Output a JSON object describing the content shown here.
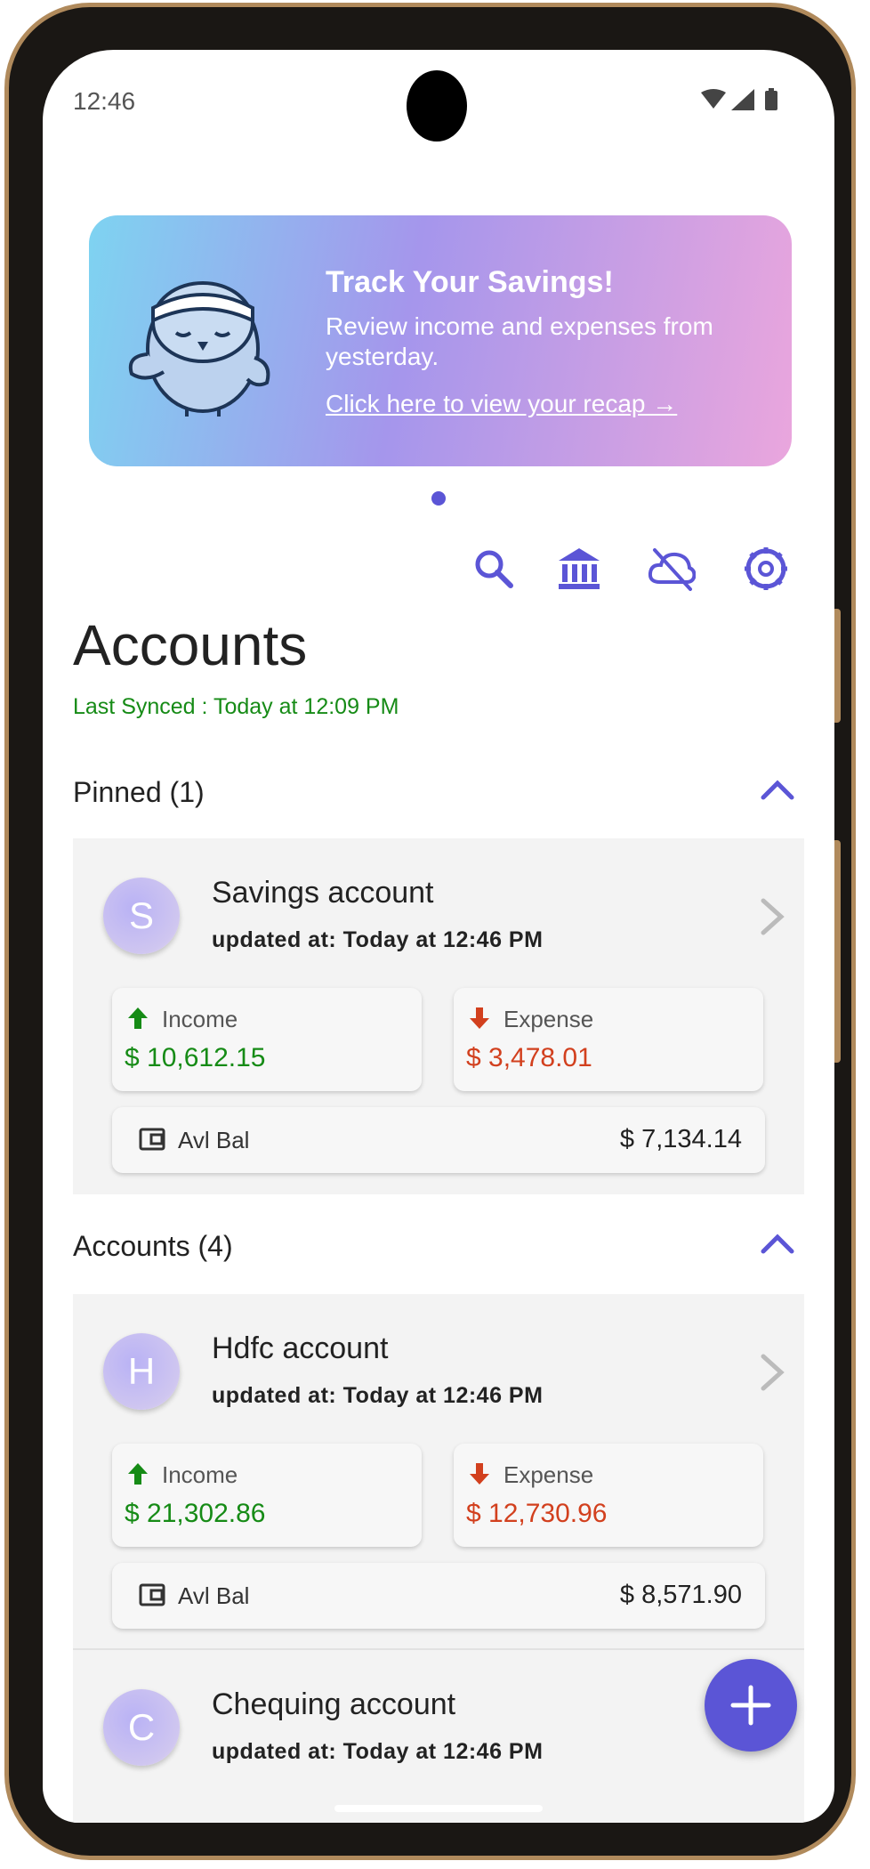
{
  "status_bar": {
    "time": "12:46"
  },
  "banner": {
    "title": "Track Your Savings!",
    "subtitle": "Review income and expenses from yesterday.",
    "link": " Click here to view your recap →"
  },
  "toolbar": {
    "icons": [
      "search-icon",
      "bank-icon",
      "cloud-off-icon",
      "settings-icon"
    ]
  },
  "page": {
    "title": "Accounts",
    "last_synced": "Last Synced : Today at 12:09 PM"
  },
  "pinned": {
    "header": "Pinned (1)",
    "accounts": [
      {
        "initial": "S",
        "name": "Savings account",
        "updated": "updated at: Today at 12:46 PM",
        "income_label": "Income",
        "income": "$ 10,612.15",
        "expense_label": "Expense",
        "expense": "$ 3,478.01",
        "balance_label": "Avl Bal",
        "balance": "$ 7,134.14"
      }
    ]
  },
  "accounts": {
    "header": "Accounts (4)",
    "items": [
      {
        "initial": "H",
        "name": "Hdfc account",
        "updated": "updated at: Today at 12:46 PM",
        "income_label": "Income",
        "income": "$ 21,302.86",
        "expense_label": "Expense",
        "expense": "$ 12,730.96",
        "balance_label": "Avl Bal",
        "balance": "$ 8,571.90"
      },
      {
        "initial": "C",
        "name": "Chequing account",
        "updated": "updated at: Today at 12:46 PM"
      }
    ]
  },
  "colors": {
    "accent": "#5b55d6",
    "income": "#168b16",
    "expense": "#d2401e",
    "synced": "#168b16"
  }
}
